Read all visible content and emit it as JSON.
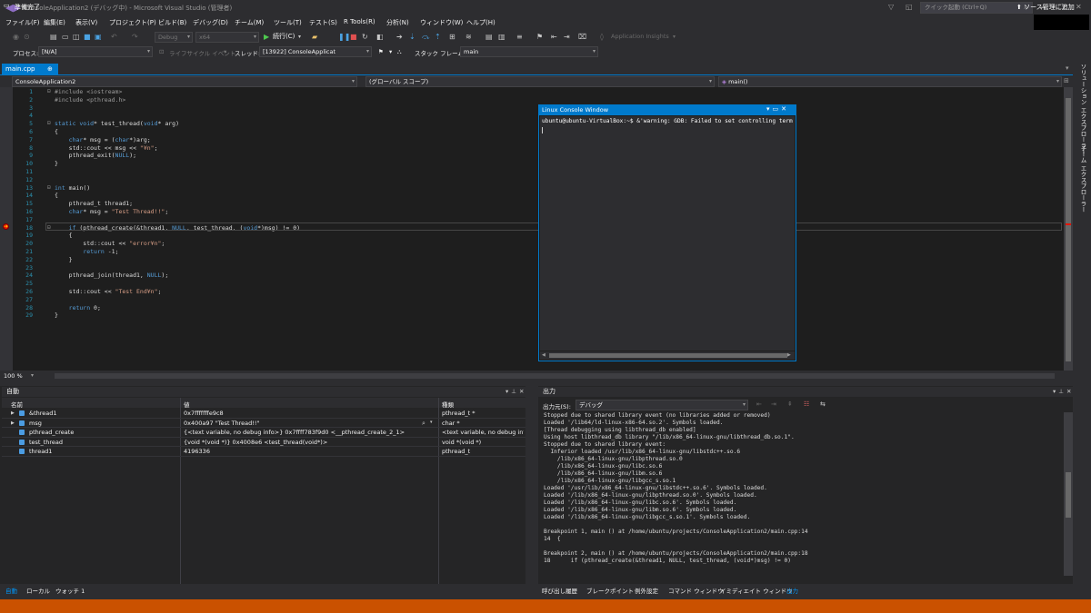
{
  "window": {
    "title": "ConsoleApplication2 (デバッグ中) - Microsoft Visual Studio (管理者)",
    "quick_launch_placeholder": "クイック起動 (Ctrl+Q)"
  },
  "menu": [
    "ファイル(F)",
    "編集(E)",
    "表示(V)",
    "プロジェクト(P)",
    "ビルド(B)",
    "デバッグ(D)",
    "チーム(M)",
    "ツール(T)",
    "テスト(S)",
    "R Tools(R)",
    "分析(N)",
    "ウィンドウ(W)",
    "ヘルプ(H)"
  ],
  "toolbar": {
    "config": "Debug",
    "platform": "x64",
    "continue_label": "続行(C)",
    "app_insights": "Application Insights"
  },
  "debugbar": {
    "process_label": "プロセス:",
    "process_value": "[N/A]",
    "lifecycle_label": "ライフサイクル イベント",
    "thread_label": "スレッド:",
    "thread_value": "[13922] ConsoleApplicat",
    "stackframe_label": "スタック フレーム:",
    "stackframe_value": "main"
  },
  "document": {
    "tab_label": "main.cpp",
    "nav_project": "ConsoleApplication2",
    "nav_scope": "(グローバル スコープ)",
    "nav_member": "main()",
    "zoom": "100 %"
  },
  "code_lines": [
    {
      "n": "1",
      "html": "<span class=\"pp\">#include &lt;iostream&gt;</span>"
    },
    {
      "n": "2",
      "html": "<span class=\"pp\">#include &lt;pthread.h&gt;</span>"
    },
    {
      "n": "3",
      "html": ""
    },
    {
      "n": "4",
      "html": ""
    },
    {
      "n": "5",
      "html": "<span class=\"kw\">static void</span>* test_thread(<span class=\"kw\">void</span>* arg)"
    },
    {
      "n": "6",
      "html": "{"
    },
    {
      "n": "7",
      "html": "    <span class=\"kw\">char</span>* msg = (<span class=\"kw\">char</span>*)arg;"
    },
    {
      "n": "8",
      "html": "    std::cout &lt;&lt; msg &lt;&lt; <span class=\"str\">\"¥n\"</span>;"
    },
    {
      "n": "9",
      "html": "    pthread_exit(<span class=\"kw\">NULL</span>);"
    },
    {
      "n": "10",
      "html": "}"
    },
    {
      "n": "11",
      "html": ""
    },
    {
      "n": "12",
      "html": ""
    },
    {
      "n": "13",
      "html": "<span class=\"kw\">int</span> main()"
    },
    {
      "n": "14",
      "html": "{"
    },
    {
      "n": "15",
      "html": "    pthread_t thread1;"
    },
    {
      "n": "16",
      "html": "    <span class=\"kw\">char</span>* msg = <span class=\"str\">\"Test Thread!!\"</span>;"
    },
    {
      "n": "17",
      "html": ""
    },
    {
      "n": "18",
      "html": "    <span class=\"kw\">if</span> (pthread_create(&amp;thread1, <span class=\"kw\">NULL</span>, test_thread, (<span class=\"kw\">void</span>*)msg) != 0)"
    },
    {
      "n": "19",
      "html": "    {"
    },
    {
      "n": "20",
      "html": "        std::cout &lt;&lt; <span class=\"str\">\"error¥n\"</span>;"
    },
    {
      "n": "21",
      "html": "        <span class=\"kw\">return</span> -1;"
    },
    {
      "n": "22",
      "html": "    }"
    },
    {
      "n": "23",
      "html": ""
    },
    {
      "n": "24",
      "html": "    pthread_join(thread1, <span class=\"kw\">NULL</span>);"
    },
    {
      "n": "25",
      "html": ""
    },
    {
      "n": "26",
      "html": "    std::cout &lt;&lt; <span class=\"str\">\"Test End¥n\"</span>;"
    },
    {
      "n": "27",
      "html": ""
    },
    {
      "n": "28",
      "html": "    <span class=\"kw\">return</span> 0;"
    },
    {
      "n": "29",
      "html": "}"
    }
  ],
  "console": {
    "title": "Linux Console Window",
    "line": "ubuntu@ubuntu-VirtualBox:~$ &'warning: GDB: Failed to set controlling terminal: \\"
  },
  "auto_pane": {
    "title": "自動",
    "col_name": "名前",
    "col_value": "値",
    "col_type": "種類",
    "rows": [
      {
        "name": "&thread1",
        "value": "0x7fffffffe9c8",
        "type": "pthread_t *",
        "expandable": true
      },
      {
        "name": "msg",
        "value": "0x400a97 \"Test Thread!!\"",
        "type": "char *",
        "expandable": true
      },
      {
        "name": "pthread_create",
        "value": "{<text variable, no debug info>} 0x7ffff783f9d0 <__pthread_create_2_1>",
        "type": "<text variable, no debug inf",
        "expandable": false
      },
      {
        "name": "test_thread",
        "value": "{void *(void *)} 0x4008e6 <test_thread(void*)>",
        "type": "void *(void *)",
        "expandable": false
      },
      {
        "name": "thread1",
        "value": "4196336",
        "type": "pthread_t",
        "expandable": false
      }
    ],
    "tabs": [
      "自動",
      "ローカル",
      "ウォッチ 1"
    ]
  },
  "output_pane": {
    "title": "出力",
    "source_label": "出力元(S):",
    "source_value": "デバッグ",
    "text": "Stopped due to shared library event (no libraries added or removed)\nLoaded '/lib64/ld-linux-x86-64.so.2'. Symbols loaded.\n[Thread debugging using libthread_db enabled]\nUsing host libthread_db library \"/lib/x86_64-linux-gnu/libthread_db.so.1\".\nStopped due to shared library event:\n  Inferior loaded /usr/lib/x86_64-linux-gnu/libstdc++.so.6\n    /lib/x86_64-linux-gnu/libpthread.so.0\n    /lib/x86_64-linux-gnu/libc.so.6\n    /lib/x86_64-linux-gnu/libm.so.6\n    /lib/x86_64-linux-gnu/libgcc_s.so.1\nLoaded '/usr/lib/x86_64-linux-gnu/libstdc++.so.6'. Symbols loaded.\nLoaded '/lib/x86_64-linux-gnu/libpthread.so.0'. Symbols loaded.\nLoaded '/lib/x86_64-linux-gnu/libc.so.6'. Symbols loaded.\nLoaded '/lib/x86_64-linux-gnu/libm.so.6'. Symbols loaded.\nLoaded '/lib/x86_64-linux-gnu/libgcc_s.so.1'. Symbols loaded.\n\nBreakpoint 1, main () at /home/ubuntu/projects/ConsoleApplication2/main.cpp:14\n14  {\n\nBreakpoint 2, main () at /home/ubuntu/projects/ConsoleApplication2/main.cpp:18\n18      if (pthread_create(&thread1, NULL, test_thread, (void*)msg) != 0)",
    "tabs": [
      "呼び出し履歴",
      "ブレークポイント",
      "例外設定",
      "コマンド ウィンドウ",
      "イミディエイト ウィンドウ",
      "出力"
    ]
  },
  "side_tabs": [
    "ソリューション エクスプローラー",
    "チーム エクスプローラー"
  ],
  "status": {
    "text": "準備完了",
    "scm": "ソース管理に追加"
  },
  "colors": {
    "accent": "#007acc",
    "status_bar": "#ca5100",
    "background": "#2d2d30"
  }
}
